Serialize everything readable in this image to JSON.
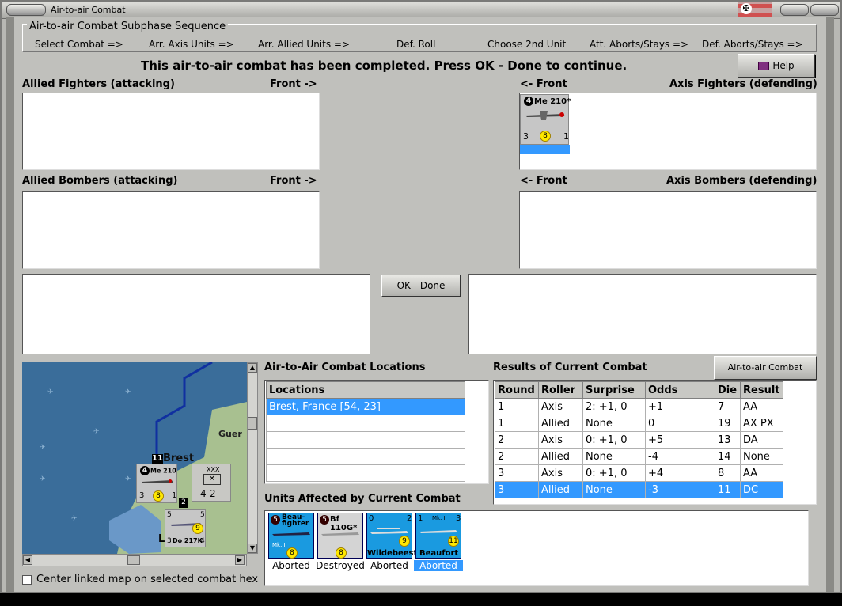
{
  "window": {
    "title": "Air-to-air Combat"
  },
  "sequence": {
    "title": "Air-to-air Combat Subphase Sequence",
    "steps": [
      "Select Combat =>",
      "Arr. Axis Units =>",
      "Arr. Allied Units =>",
      "Def. Roll",
      "Choose 2nd Unit",
      "Att. Aborts/Stays =>",
      "Def. Aborts/Stays =>"
    ]
  },
  "message": "This air-to-air combat has been completed.  Press OK - Done to continue.",
  "help_label": "Help",
  "panels": {
    "allied_fighters": "Allied Fighters (attacking)",
    "front_right_1": "Front ->",
    "axis_fighters": "Axis Fighters (defending)",
    "front_left_1": "<- Front",
    "allied_bombers": "Allied Bombers (attacking)",
    "front_right_2": "Front ->",
    "axis_bombers": "Axis Bombers (defending)",
    "front_left_2": "<- Front"
  },
  "axis_fighter_unit": {
    "name": "Me 210*",
    "badge": "4",
    "attack": "3",
    "range": "8",
    "move": "1"
  },
  "ok_label": "OK - Done",
  "map": {
    "city": "Brest",
    "city_badge": "11",
    "guer_label": "Guer",
    "hex_badge": "2",
    "stack1": {
      "name": "Me 210",
      "badge": "4",
      "a": "3",
      "b": "8",
      "c": "1"
    },
    "corps": {
      "type": "XXX",
      "value": "4-2"
    },
    "stack2": {
      "name": "Do 217K",
      "a": "3",
      "b": "9",
      "c": "4",
      "t": "5",
      "t2": "5"
    },
    "letter": "L"
  },
  "center_linked_label": "Center linked map on selected combat hex",
  "locations": {
    "title": "Air-to-Air Combat Locations",
    "header": "Locations",
    "rows": [
      "Brest, France [54, 23]",
      "",
      "",
      "",
      ""
    ]
  },
  "results": {
    "title": "Results of Current Combat",
    "chart_button": "Air-to-air Combat Chart",
    "headers": [
      "Round",
      "Roller",
      "Surprise",
      "Odds",
      "Die",
      "Result"
    ],
    "rows": [
      [
        "1",
        "Axis",
        "2: +1, 0",
        "+1",
        "7",
        "AA"
      ],
      [
        "1",
        "Allied",
        "None",
        "0",
        "19",
        "AX PX"
      ],
      [
        "2",
        "Axis",
        "0: +1, 0",
        "+5",
        "13",
        "DA"
      ],
      [
        "2",
        "Allied",
        "None",
        "-4",
        "14",
        "None"
      ],
      [
        "3",
        "Axis",
        "0: +1, 0",
        "+4",
        "8",
        "AA"
      ],
      [
        "3",
        "Allied",
        "None",
        "-3",
        "11",
        "DC"
      ]
    ]
  },
  "affected": {
    "title": "Units Affected by Current Combat",
    "units": [
      {
        "name": "Beau-fighter",
        "badge": "5",
        "sub": "Mk. I",
        "value": "8",
        "status": "Aborted",
        "color": "#1a9ae0"
      },
      {
        "name": "Bf 110G*",
        "badge": "5",
        "value": "8",
        "status": "Destroyed",
        "color": "#d0d0d0"
      },
      {
        "name": "Wildebeest",
        "left": "0",
        "right": "2",
        "value": "9",
        "status": "Aborted",
        "color": "#1a9ae0"
      },
      {
        "name": "Beaufort",
        "left": "1",
        "right": "3",
        "sub": "Mk. I",
        "value": "11",
        "status": "Aborted",
        "color": "#1a9ae0"
      }
    ]
  },
  "colors": {
    "selection": "#3399ff",
    "sea": "#3a6d9a",
    "land": "#a8c090"
  }
}
